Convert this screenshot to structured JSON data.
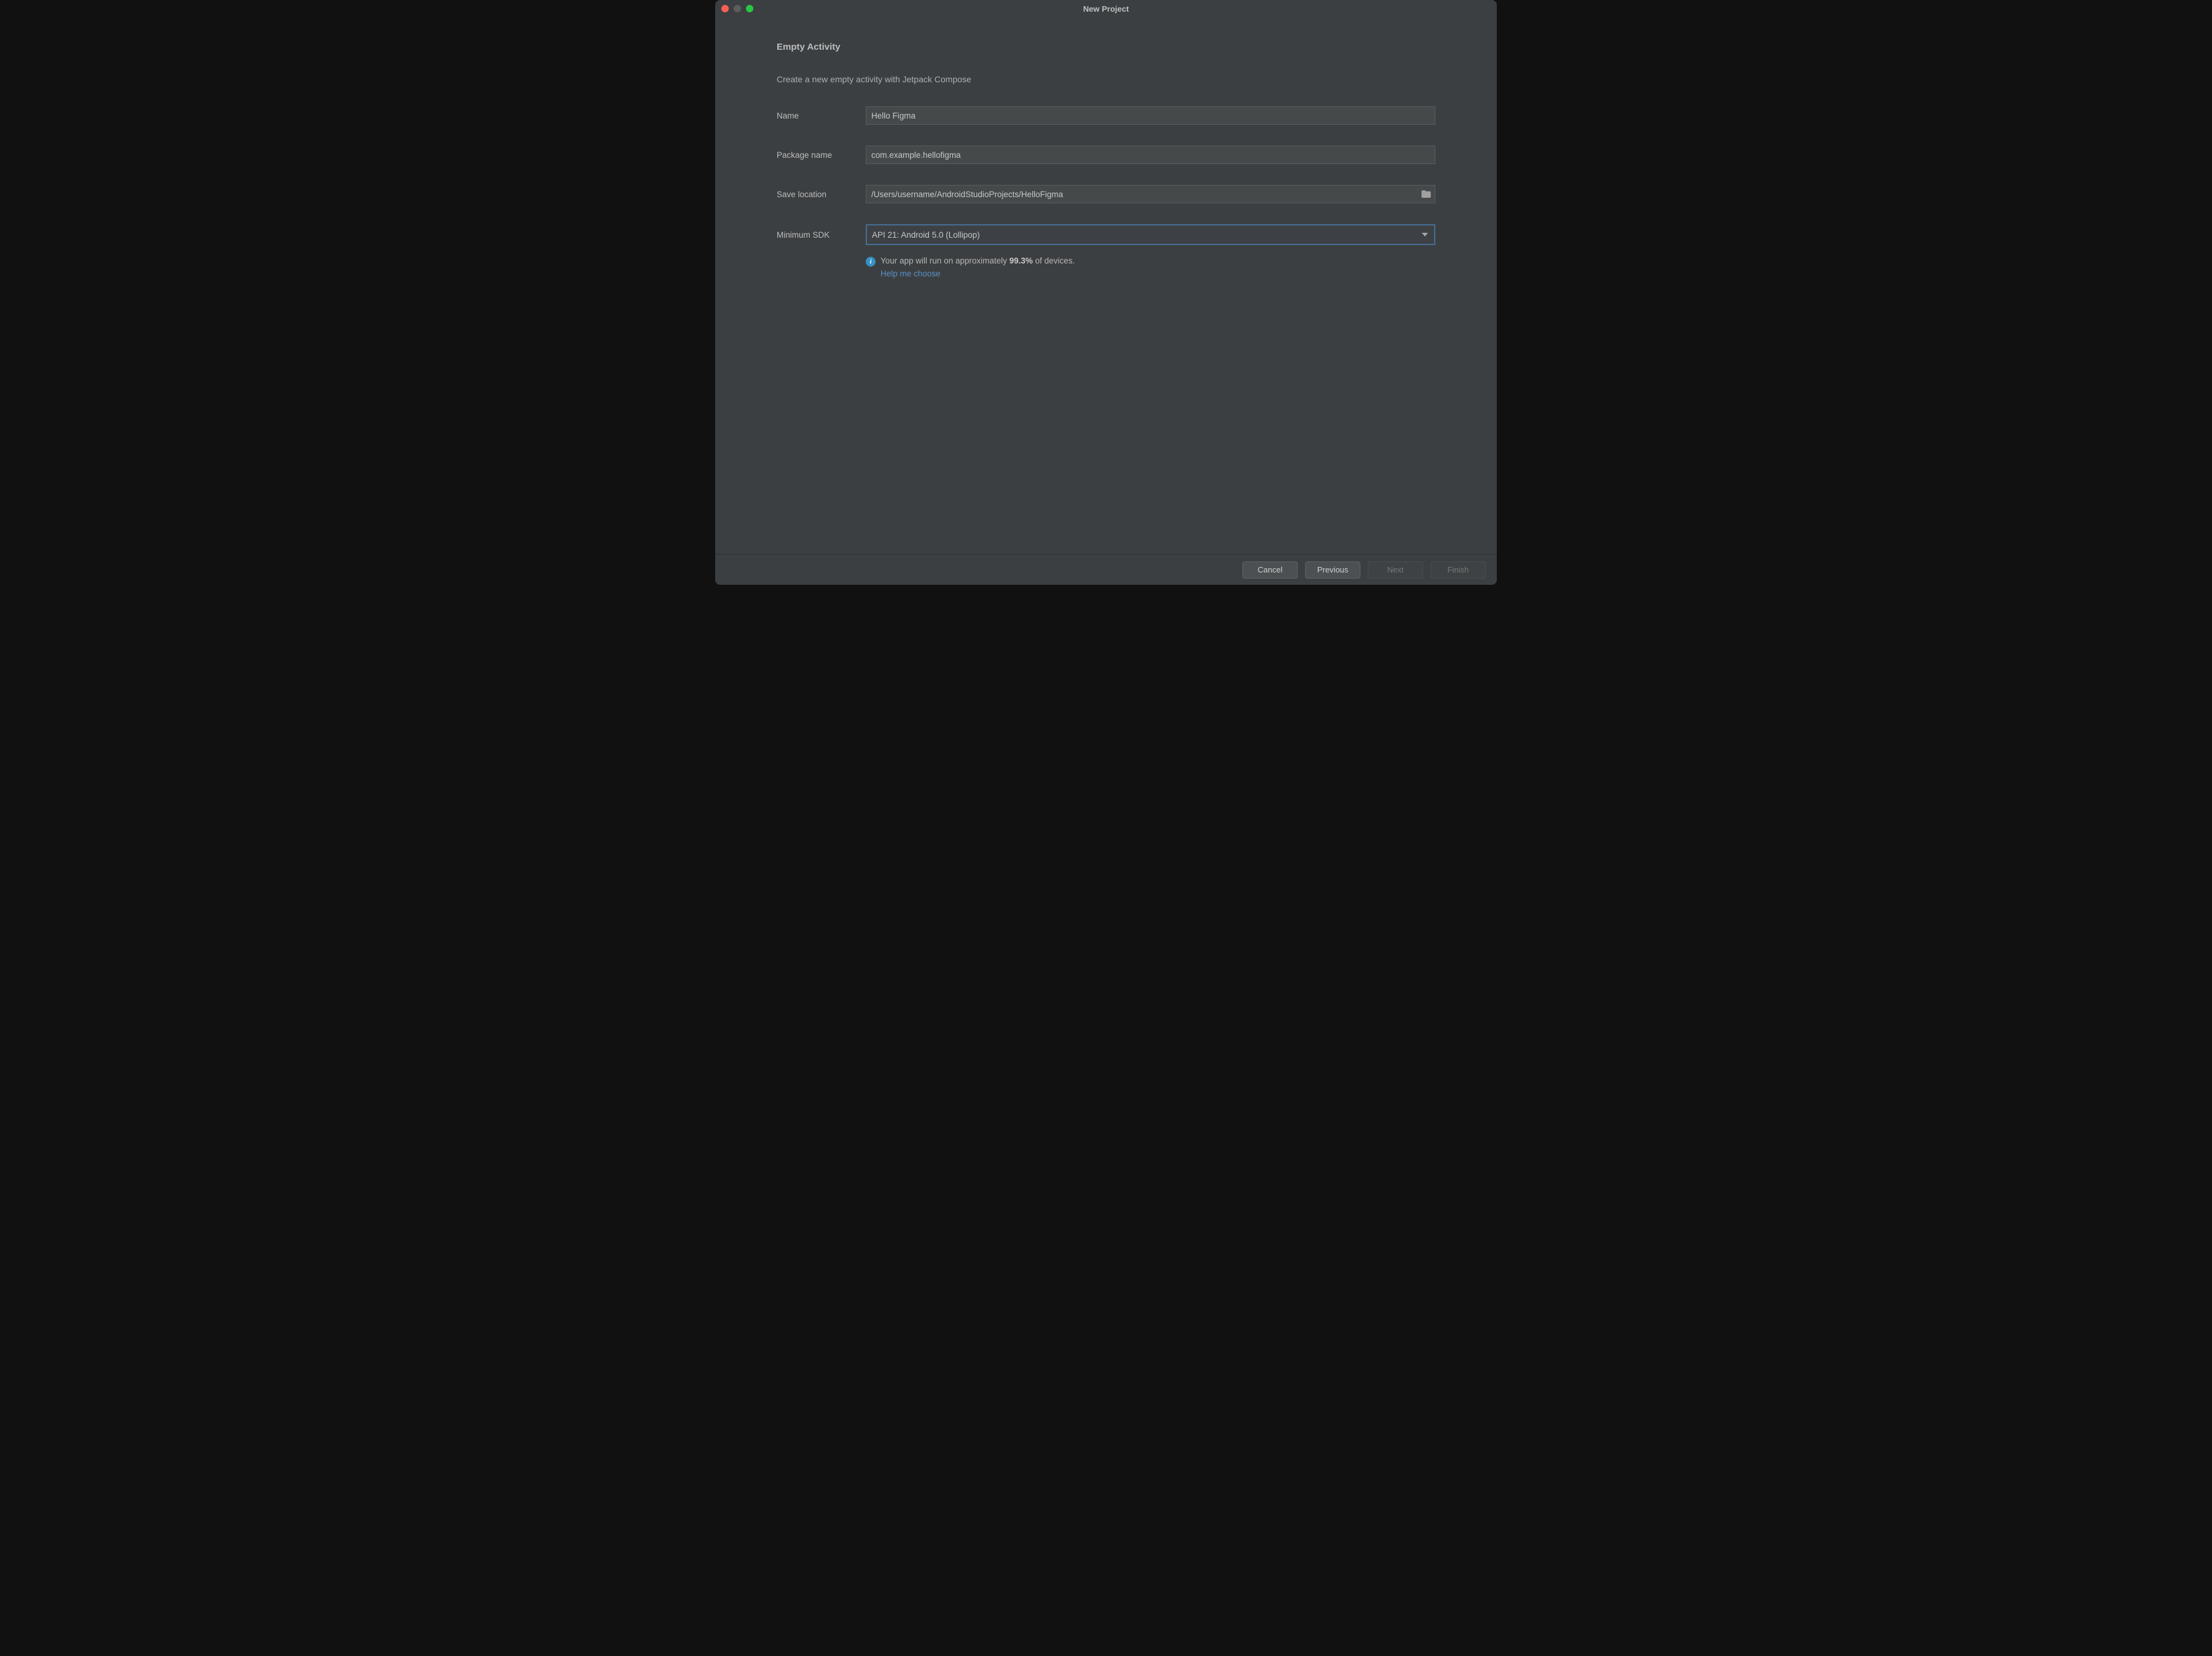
{
  "window": {
    "title": "New Project"
  },
  "header": {
    "heading": "Empty Activity",
    "subheading": "Create a new empty activity with Jetpack Compose"
  },
  "form": {
    "name_label": "Name",
    "name_value": "Hello Figma",
    "package_label": "Package name",
    "package_value": "com.example.hellofigma",
    "location_label": "Save location",
    "location_value": "/Users/username/AndroidStudioProjects/HelloFigma",
    "sdk_label": "Minimum SDK",
    "sdk_value": "API 21: Android 5.0 (Lollipop)"
  },
  "info": {
    "prefix": "Your app will run on approximately ",
    "percent": "99.3%",
    "suffix": " of devices.",
    "help_link": "Help me choose"
  },
  "buttons": {
    "cancel": "Cancel",
    "previous": "Previous",
    "next": "Next",
    "finish": "Finish"
  }
}
